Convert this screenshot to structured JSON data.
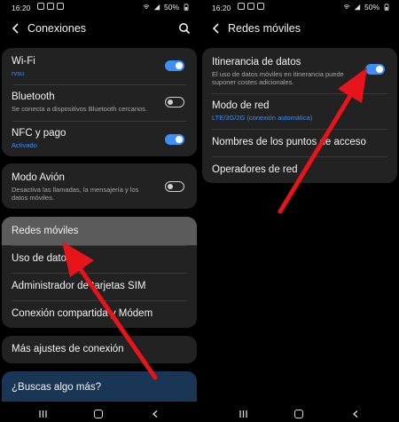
{
  "left": {
    "status": {
      "time": "16:20",
      "battery": "50%"
    },
    "header": {
      "title": "Conexiones"
    },
    "groups": [
      [
        {
          "label": "Wi-Fi",
          "sub": "rvsu",
          "sub_color": "blue",
          "toggle": "on"
        },
        {
          "label": "Bluetooth",
          "sub": "Se conecta a dispositivos Bluetooth cercanos.",
          "sub_color": "gray",
          "toggle": "off"
        },
        {
          "label": "NFC y pago",
          "sub": "Activado",
          "sub_color": "blue",
          "toggle": "on"
        }
      ],
      [
        {
          "label": "Modo Avión",
          "sub": "Desactiva las llamadas, la mensajería y los datos móviles.",
          "sub_color": "gray",
          "toggle": "off"
        }
      ],
      [
        {
          "label": "Redes móviles",
          "selected": true
        },
        {
          "label": "Uso de datos"
        },
        {
          "label": "Administrador de tarjetas SIM"
        },
        {
          "label": "Conexión compartida y Módem"
        }
      ],
      [
        {
          "label": "Más ajustes de conexión"
        }
      ]
    ],
    "help": {
      "label": "¿Buscas algo más?"
    }
  },
  "right": {
    "status": {
      "time": "16:20",
      "battery": "50%"
    },
    "header": {
      "title": "Redes móviles"
    },
    "items": [
      {
        "label": "Itinerancia de datos",
        "sub": "El uso de datos móviles en itinerancia puede suponer costes adicionales.",
        "sub_color": "gray",
        "toggle": "on"
      },
      {
        "label": "Modo de red",
        "sub": "LTE/3G/2G (conexión automática)",
        "sub_color": "blue"
      },
      {
        "label": "Nombres de los puntos de acceso"
      },
      {
        "label": "Operadores de red"
      }
    ]
  },
  "colors": {
    "accent": "#3e8ef7",
    "card": "#222222",
    "selected": "#5b5b5b",
    "help_card": "#1a3656",
    "arrow": "#e8141b"
  },
  "icons": [
    "back-arrow-icon",
    "search-icon",
    "wifi-icon",
    "battery-icon",
    "recents-icon",
    "home-icon",
    "nav-back-icon"
  ]
}
